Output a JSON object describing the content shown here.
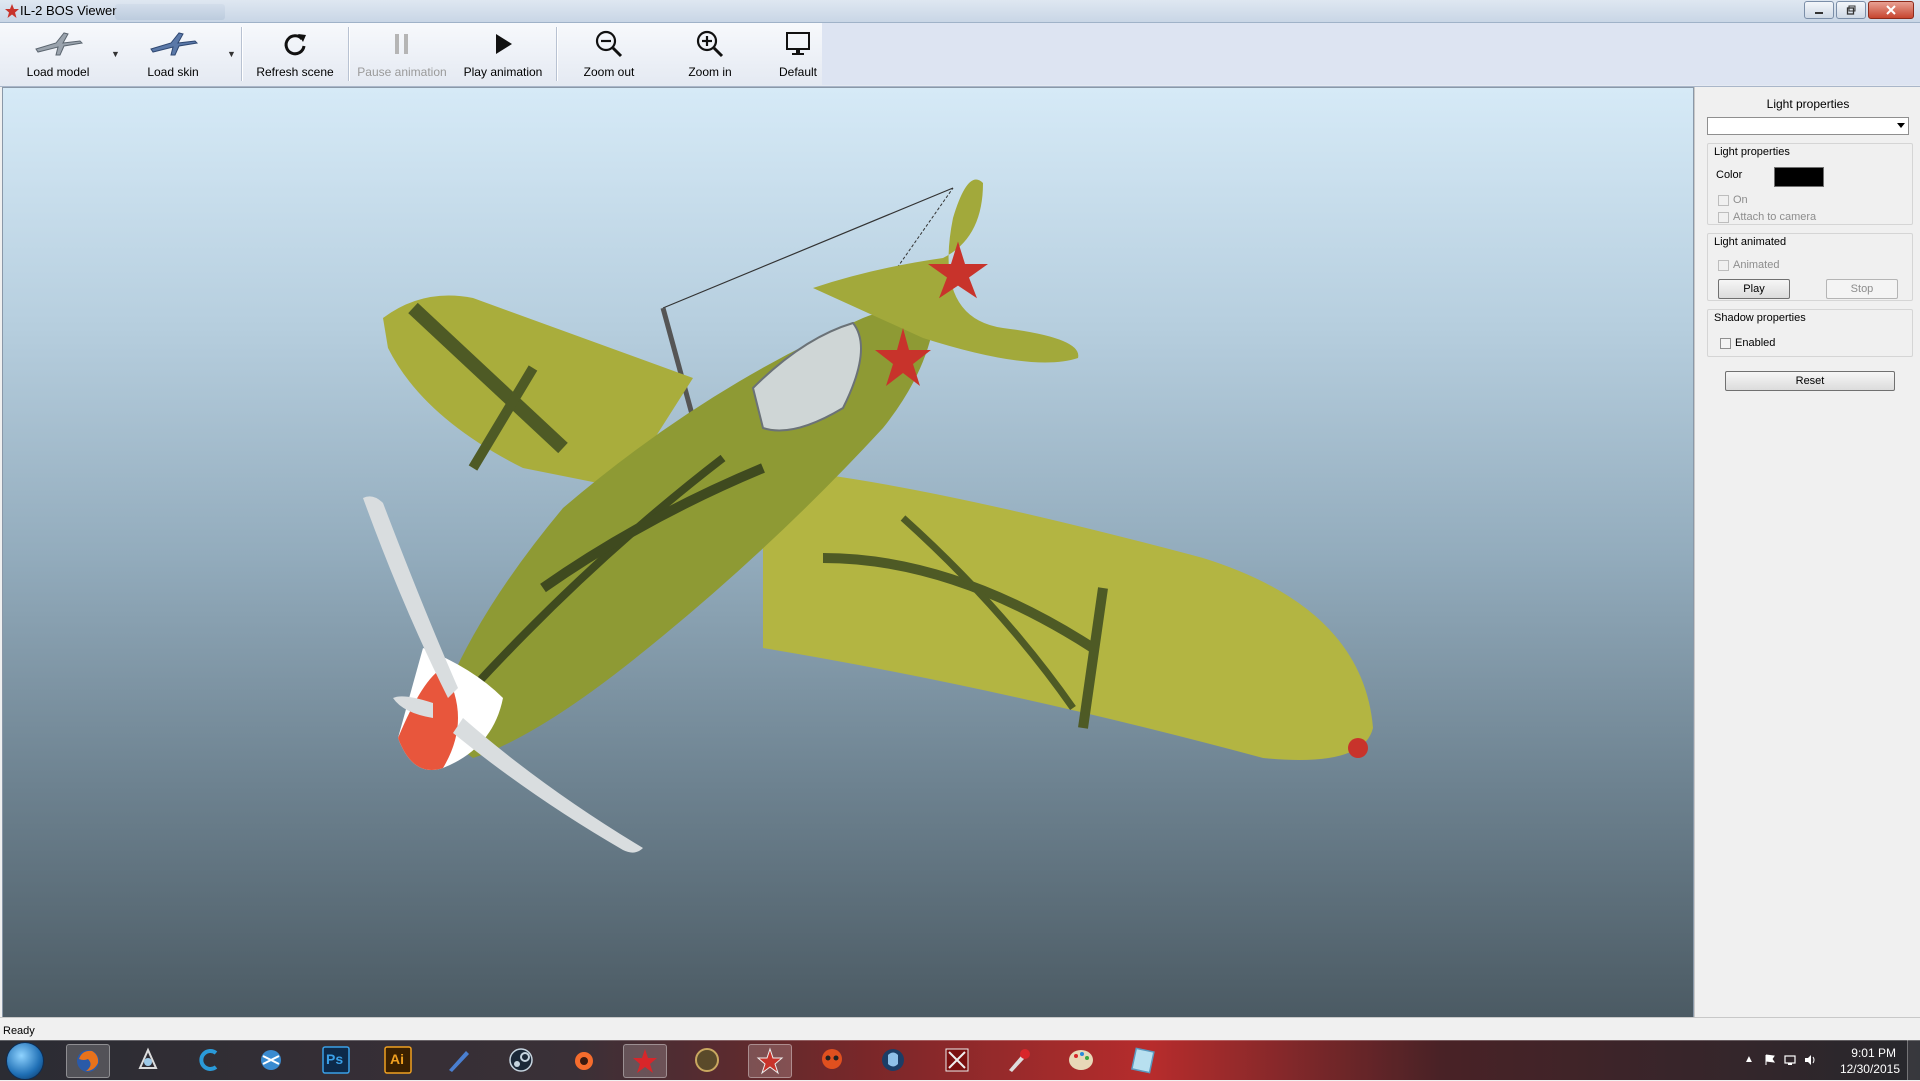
{
  "window": {
    "title": "IL-2 BOS Viewer"
  },
  "toolbar": {
    "load_model": "Load model",
    "load_skin": "Load skin",
    "refresh_scene": "Refresh scene",
    "pause_animation": "Pause animation",
    "play_animation": "Play animation",
    "zoom_out": "Zoom out",
    "zoom_in": "Zoom in",
    "default": "Default"
  },
  "panel": {
    "title": "Light properties",
    "dropdown_value": "",
    "light_group": {
      "label": "Light properties",
      "color_label": "Color",
      "color_value": "#000000",
      "on_label": "On",
      "attach_label": "Attach to camera"
    },
    "animated_group": {
      "label": "Light animated",
      "animated_label": "Animated",
      "play": "Play",
      "stop": "Stop"
    },
    "shadow_group": {
      "label": "Shadow properties",
      "enabled_label": "Enabled"
    },
    "reset": "Reset"
  },
  "status": {
    "text": "Ready"
  },
  "taskbar": {
    "icons": [
      "windows-start-icon",
      "firefox-icon",
      "3d-app-icon",
      "c-app-icon",
      "network-icon",
      "photoshop-icon",
      "illustrator-icon",
      "pen-tool-icon",
      "steam-icon",
      "origin-icon",
      "red-star-icon",
      "medal-icon",
      "star-app-icon",
      "skull-app-icon",
      "teamspeak-icon",
      "game-app-icon",
      "paint-brush-icon",
      "palette-icon",
      "notes-icon"
    ],
    "photoshop_label": "Ps",
    "illustrator_label": "Ai",
    "clock_time": "9:01 PM",
    "clock_date": "12/30/2015"
  },
  "colors": {
    "plane_green": "#8e9a34",
    "plane_yellow": "#b8b845",
    "spinner_red": "#e8563c",
    "star_red": "#c8332b",
    "toolbar_blank": "#dde4f2"
  }
}
